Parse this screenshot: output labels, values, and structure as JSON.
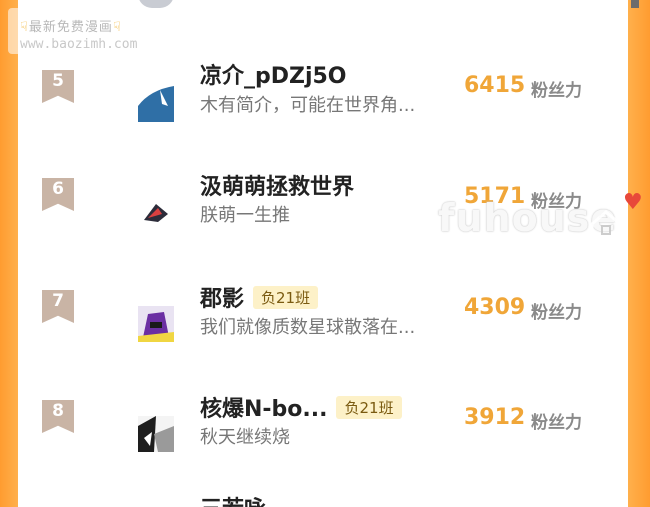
{
  "watermark": {
    "line1": "最新免费漫画",
    "line2": "www.baozimh.com"
  },
  "score_unit": "粉丝力",
  "rows": [
    {
      "rank": "5",
      "name": "凉介_pDZj5O",
      "tag": "",
      "desc": "木有简介，可能在世界角...",
      "score": "6415"
    },
    {
      "rank": "6",
      "name": "汲萌萌拯救世界",
      "tag": "",
      "desc": "朕萌一生推",
      "score": "5171"
    },
    {
      "rank": "7",
      "name": "郡影",
      "tag": "负21班",
      "desc": "我们就像质数星球散落在...",
      "score": "4309"
    },
    {
      "rank": "8",
      "name": "核爆N-bo...",
      "tag": "负21班",
      "desc": "秋天继续烧",
      "score": "3912"
    },
    {
      "rank": "",
      "name": "三若咏",
      "tag": "",
      "desc": "",
      "score": ""
    }
  ],
  "overlay": {
    "brand": "fuhouse"
  },
  "colors": {
    "accent": "#f0a638",
    "side": "#ff9c30",
    "badge": "#c9b4a5",
    "tag_bg": "#fdf1c8"
  }
}
